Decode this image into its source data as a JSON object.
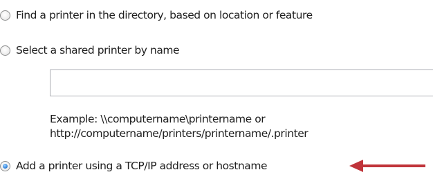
{
  "options": [
    {
      "label": "Find a printer in the directory, based on location or feature",
      "selected": false
    },
    {
      "label": "Select a shared printer by name",
      "selected": false
    },
    {
      "label": "Add a printer using a TCP/IP address or hostname",
      "selected": true
    }
  ],
  "shared_printer": {
    "value": "",
    "example_line1": "Example: \\\\computername\\printername or",
    "example_line2": "http://computername/printers/printername/.printer"
  },
  "annotation": {
    "arrow_color": "#c0343a"
  }
}
